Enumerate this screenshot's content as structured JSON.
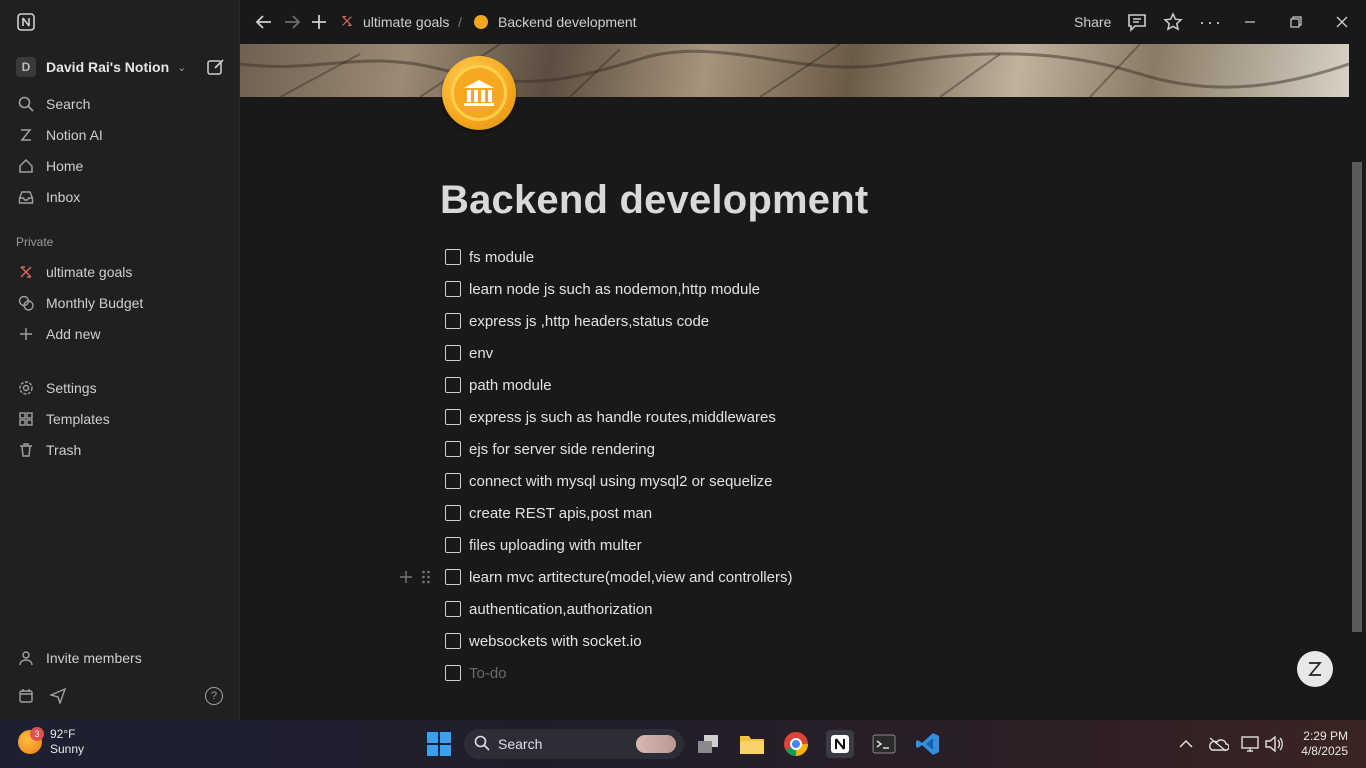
{
  "window": {
    "breadcrumb_parent": "ultimate goals",
    "breadcrumb_current": "Backend development",
    "share_label": "Share"
  },
  "sidebar": {
    "workspace_initial": "D",
    "workspace_name": "David Rai's Notion",
    "top_items": [
      "Search",
      "Notion AI",
      "Home",
      "Inbox"
    ],
    "section_label": "Private",
    "private_items": [
      "ultimate goals",
      "Monthly Budget",
      "Add new"
    ],
    "bottom_items": [
      "Settings",
      "Templates",
      "Trash"
    ],
    "invite_label": "Invite members"
  },
  "page": {
    "title": "Backend development",
    "todos": [
      "fs module",
      "learn node js such as nodemon,http module",
      "express js ,http headers,status code",
      "env",
      "path module",
      "express js such as handle routes,middlewares",
      "ejs for server side rendering",
      "connect with mysql using mysql2 or sequelize",
      "create REST apis,post man",
      "files uploading with multer",
      "learn mvc artitecture(model,view and controllers)",
      "authentication,authorization",
      "websockets with socket.io"
    ],
    "todo_placeholder": "To-do"
  },
  "taskbar": {
    "weather_badge": "3",
    "temperature": "92°F",
    "condition": "Sunny",
    "search_label": "Search",
    "time": "2:29 PM",
    "date": "4/8/2025"
  }
}
